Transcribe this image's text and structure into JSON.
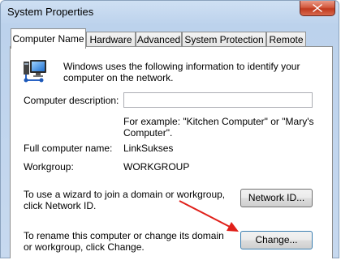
{
  "window": {
    "title": "System Properties"
  },
  "tabs": [
    {
      "label": "Computer Name",
      "active": true
    },
    {
      "label": "Hardware",
      "active": false
    },
    {
      "label": "Advanced",
      "active": false
    },
    {
      "label": "System Protection",
      "active": false
    },
    {
      "label": "Remote",
      "active": false
    }
  ],
  "panel": {
    "intro": "Windows uses the following information to identify your computer on the network.",
    "description_label": "Computer description:",
    "description_value": "",
    "description_hint": "For example: \"Kitchen Computer\" or \"Mary's Computer\".",
    "full_name_label": "Full computer name:",
    "full_name_value": "LinkSukses",
    "workgroup_label": "Workgroup:",
    "workgroup_value": "WORKGROUP",
    "network_id_text": "To use a wizard to join a domain or workgroup, click Network ID.",
    "network_id_button": "Network ID...",
    "rename_text": "To rename this computer or change its domain or workgroup, click Change.",
    "change_button": "Change..."
  },
  "colors": {
    "arrow": "#e0201a",
    "close_button": "#c9452a"
  },
  "icons": [
    "computer-network-icon",
    "close-icon"
  ]
}
